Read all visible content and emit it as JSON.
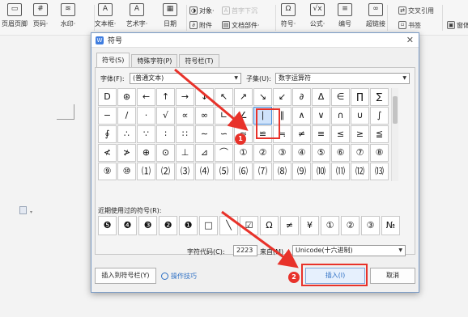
{
  "ribbon": {
    "big": [
      {
        "label": "页眉页脚",
        "icon": "header-footer-icon"
      },
      {
        "label": "页码·",
        "icon": "page-number-icon"
      },
      {
        "label": "水印·",
        "icon": "watermark-icon"
      },
      {
        "label": "文本框·",
        "icon": "textbox-icon"
      },
      {
        "label": "艺术字·",
        "icon": "wordart-icon"
      },
      {
        "label": "日期",
        "icon": "date-icon"
      },
      {
        "label": "符号·",
        "icon": "symbol-icon"
      },
      {
        "label": "公式·",
        "icon": "formula-icon"
      },
      {
        "label": "编号",
        "icon": "numbering-icon"
      },
      {
        "label": "超链接",
        "icon": "hyperlink-icon"
      }
    ],
    "small": {
      "object": "对象·",
      "first_letter_sink": "首字下沉",
      "attachment": "附件",
      "doc_parts": "文档部件·",
      "cross_ref": "交叉引用",
      "bookmark": "书签",
      "edge_item": "窗体"
    }
  },
  "dialog": {
    "title": "符号",
    "tabs": [
      "符号(S)",
      "特殊字符(P)",
      "符号栏(T)"
    ],
    "font_label": "字体(F):",
    "font_value": "(普通文本)",
    "subset_label": "子集(U):",
    "subset_value": "数字运算符",
    "symbols": [
      [
        "D",
        "⊛",
        "←",
        "↑",
        "→",
        "↓",
        "↖",
        "↗",
        "↘",
        "↙",
        "∂",
        "Δ",
        "∈",
        "∏",
        "∑"
      ],
      [
        "−",
        "/",
        "·",
        "√",
        "∝",
        "∞",
        "∟",
        "∠",
        "∣",
        "∥",
        "∧",
        "∨",
        "∩",
        "∪",
        "∫"
      ],
      [
        "∮",
        "∴",
        "∵",
        "∶",
        "∷",
        "∼",
        "∽",
        "≈",
        "≌",
        "≒",
        "≠",
        "≡",
        "≤",
        "≥",
        "≦",
        "≧"
      ],
      [
        "≮",
        "≯",
        "⊕",
        "⊙",
        "⊥",
        "⊿",
        "⌒",
        "①",
        "②",
        "③",
        "④",
        "⑤",
        "⑥",
        "⑦",
        "⑧"
      ],
      [
        "⑨",
        "⑩",
        "⑴",
        "⑵",
        "⑶",
        "⑷",
        "⑸",
        "⑹",
        "⑺",
        "⑻",
        "⑼",
        "⑽",
        "⑾",
        "⑿",
        "⒀"
      ]
    ],
    "selected_symbol": "∣",
    "recent_label": "近期使用过的符号(R):",
    "recent": [
      "❺",
      "❹",
      "❸",
      "❷",
      "❶",
      "□",
      "╲",
      "☑",
      "Ω",
      "≠",
      "¥",
      "①",
      "②",
      "③",
      "№"
    ],
    "char_code_label": "字符代码(C):",
    "char_code_value": "2223",
    "from_label": "来自(M)",
    "encoding_value": "Unicode(十六进制)",
    "insert_to_bar": "插入到符号栏(Y)",
    "tips": "操作技巧",
    "insert": "插入(I)",
    "cancel": "取消"
  },
  "annotations": {
    "badge1": "1",
    "badge2": "2",
    "accent": "#e8322a"
  },
  "colors": {
    "selection": "#cfe3fb",
    "link": "#2d6fc4"
  }
}
